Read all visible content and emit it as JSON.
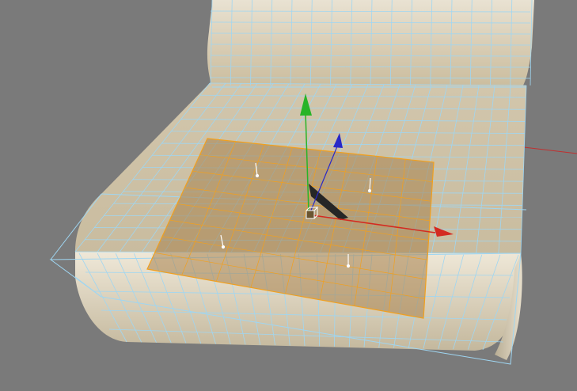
{
  "viewport": {
    "background": "#7a7a7a",
    "surface_color": "#d8ccb3",
    "surface_highlight": "#efe6d2",
    "surface_shadow": "#a89d86",
    "wire_color": "#9fd6f2",
    "selection_color": "#f0a020",
    "selection_fill": "#a8814c"
  },
  "gizmo": {
    "x_axis_color": "#d42a20",
    "y_axis_color": "#28b428",
    "z_axis_color": "#2828c8",
    "center_icon": "pivot-box-icon"
  },
  "axes": {
    "world_x_color": "#c03030"
  }
}
